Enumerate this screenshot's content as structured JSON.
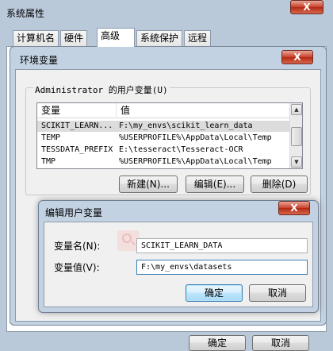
{
  "outer_window": {
    "title": "系统属性",
    "close_glyph": "X",
    "tabs": [
      {
        "label": "计算机名",
        "active": false
      },
      {
        "label": "硬件",
        "active": false
      },
      {
        "label": "高级",
        "active": true
      },
      {
        "label": "系统保护",
        "active": false
      },
      {
        "label": "远程",
        "active": false
      }
    ],
    "ok_label": "确定",
    "cancel_label": "取消"
  },
  "env_window": {
    "title": "环境变量",
    "close_glyph": "X",
    "user_vars_title": "Administrator 的用户变量(U)",
    "columns": [
      "变量",
      "值"
    ],
    "rows": [
      {
        "name": "SCIKIT_LEARN...",
        "value": "F:\\my_envs\\scikit_learn_data",
        "selected": true
      },
      {
        "name": "TEMP",
        "value": "%USERPROFILE%\\AppData\\Local\\Temp",
        "selected": false
      },
      {
        "name": "TESSDATA_PREFIX",
        "value": "E:\\tesseract\\Tesseract-OCR",
        "selected": false
      },
      {
        "name": "TMP",
        "value": "%USERPROFILE%\\AppData\\Local\\Temp",
        "selected": false
      }
    ],
    "new_label": "新建(N)...",
    "edit_label": "编辑(E)...",
    "delete_label": "删除(D)"
  },
  "edit_dialog": {
    "title": "编辑用户变量",
    "close_glyph": "X",
    "name_label": "变量名(N):",
    "name_value": "SCIKIT_LEARN_DATA",
    "value_label": "变量值(V):",
    "value_value": "F:\\my_envs\\datasets",
    "ok_label": "确定",
    "cancel_label": "取消"
  },
  "colors": {
    "glass": "#b9c9da",
    "close_red": "#c8402c",
    "selection": "#dcdcdc",
    "focus_border": "#3c7fb1"
  }
}
